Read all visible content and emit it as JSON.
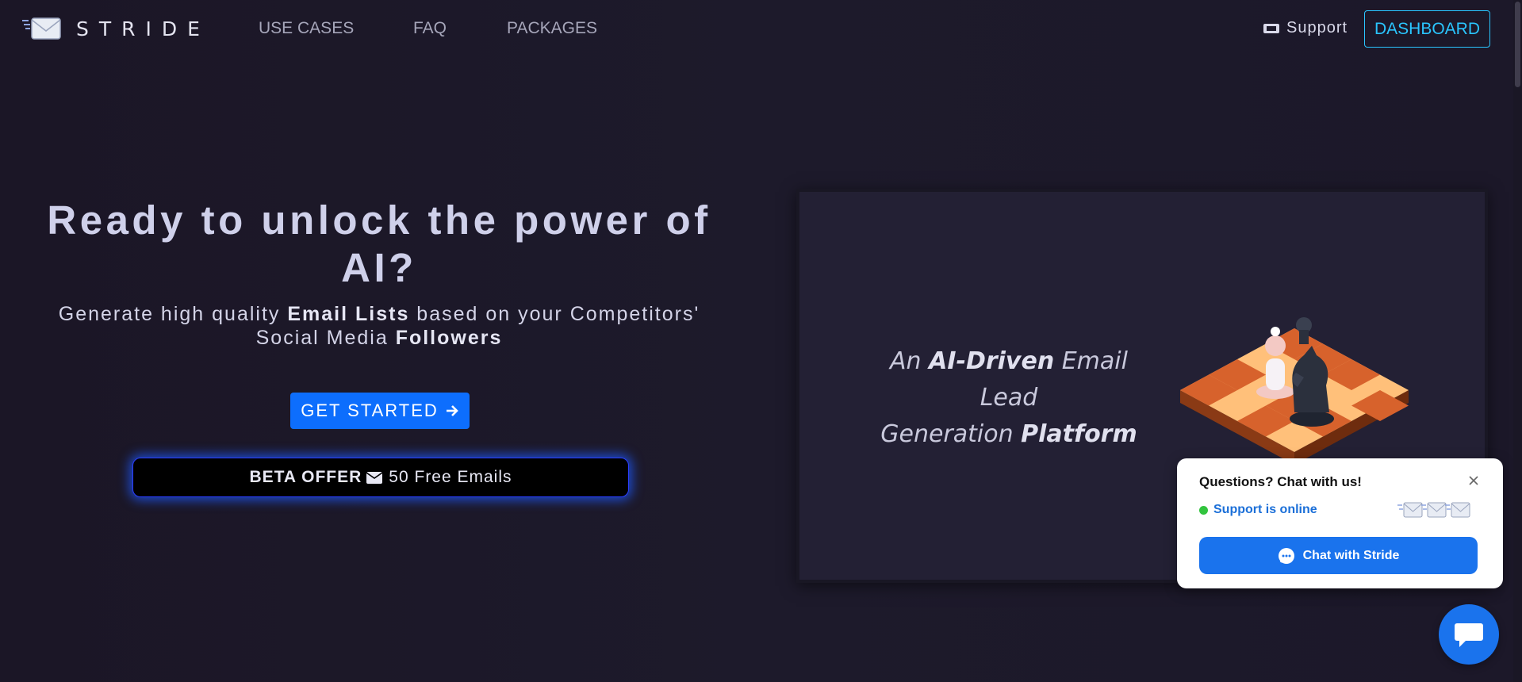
{
  "nav": {
    "brand": "STRIDE",
    "links": [
      {
        "label": "USE CASES"
      },
      {
        "label": "FAQ"
      },
      {
        "label": "PACKAGES"
      }
    ],
    "support_label": "Support",
    "dashboard_label": "DASHBOARD"
  },
  "hero": {
    "title": "Ready to unlock the power of AI?",
    "subtitle": {
      "part1": "Generate high quality ",
      "bold1": "Email Lists",
      "part2": " based on your Competitors' Social Media ",
      "bold2": "Followers"
    },
    "cta_label": "GET STARTED",
    "beta": {
      "bold": "BETA OFFER",
      "text": "50 Free Emails"
    }
  },
  "panel": {
    "line1_pre": "An ",
    "line1_bold": "AI-Driven",
    "line1_post": " Email Lead",
    "line2_pre": "Generation ",
    "line2_bold": "Platform"
  },
  "chat": {
    "title": "Questions? Chat with us!",
    "status": "Support is online",
    "button_label": "Chat with Stride"
  },
  "colors": {
    "background": "#1c1829",
    "accent": "#0d6efd",
    "dashboard_border": "#2ac5ff",
    "chat_blue": "#1a73ed",
    "online_green": "#32c43e"
  },
  "icons": [
    "envelope-logo-icon",
    "ticket-icon",
    "arrow-right-icon",
    "envelope-icon",
    "close-icon",
    "chat-icon",
    "chat-bubble-icon"
  ]
}
